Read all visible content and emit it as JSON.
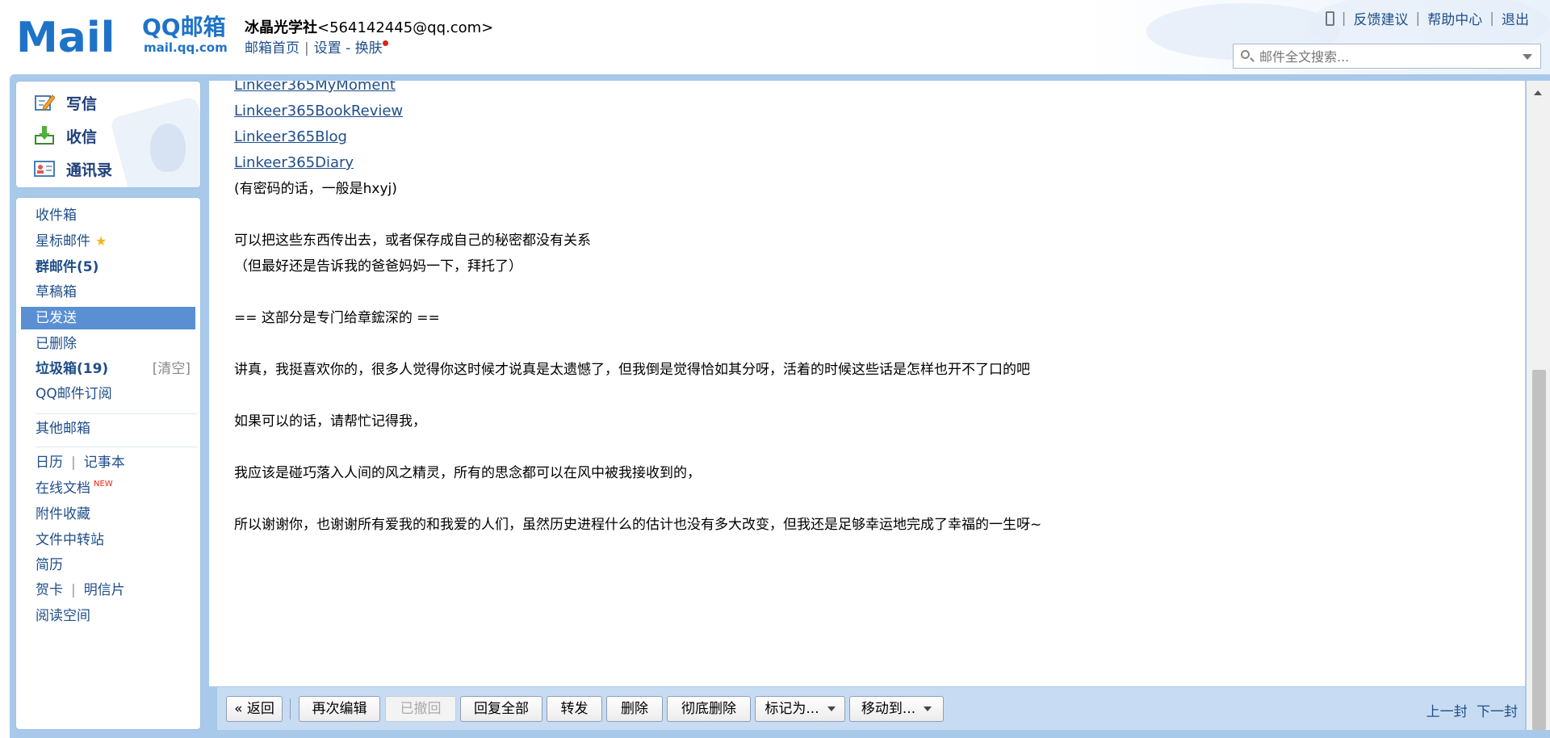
{
  "header": {
    "logo_text": "Mail",
    "logo_cn": "QQ邮箱",
    "logo_domain": "mail.qq.com",
    "account_name": "冰晶光学社",
    "account_email": "<564142445@qq.com>",
    "links": {
      "home": "邮箱首页",
      "settings": "设置",
      "dash": "-",
      "skin": "换肤"
    },
    "top_links": {
      "feedback": "反馈建议",
      "help": "帮助中心",
      "logout": "退出"
    },
    "search_placeholder": "邮件全文搜索..."
  },
  "sidebar": {
    "quick": {
      "compose": "写信",
      "inbox_check": "收信",
      "contacts": "通讯录"
    },
    "folders": {
      "inbox": "收件箱",
      "starred": "星标邮件",
      "groups": "群邮件(5)",
      "drafts": "草稿箱",
      "sent": "已发送",
      "deleted": "已删除",
      "spam": "垃圾箱(19)",
      "spam_clear": "[清空]",
      "subscriptions": "QQ邮件订阅",
      "other_mailboxes": "其他邮箱",
      "calendar": "日历",
      "notes": "记事本",
      "online_docs": "在线文档",
      "new_badge": "NEW",
      "attachments": "附件收藏",
      "file_transfer": "文件中转站",
      "resume": "简历",
      "cards": "贺卡",
      "postcards": "明信片",
      "reading": "阅读空间"
    }
  },
  "mail": {
    "partial_top": "Linkeer365MyMoment",
    "link1": "Linkeer365BookReview",
    "link2": "Linkeer365Blog",
    "link3": "Linkeer365Diary",
    "l_pw": "(有密码的话，一般是hxyj)",
    "l_share": "可以把这些东西传出去，或者保存成自己的秘密都没有关系",
    "l_parents": "（但最好还是告诉我的爸爸妈妈一下，拜托了）",
    "l_section": "== 这部分是专门给章鋐深的 ==",
    "l_like": "讲真，我挺喜欢你的，很多人觉得你这时候才说真是太遗憾了，但我倒是觉得恰如其分呀，活着的时候这些话是怎样也开不了口的吧",
    "l_remember": "如果可以的话，请帮忙记得我，",
    "l_wind": "我应该是碰巧落入人间的风之精灵，所有的思念都可以在风中被我接收到的，",
    "l_thanks": "所以谢谢你，也谢谢所有爱我的和我爱的人们，虽然历史进程什么的估计也没有多大改变，但我还是足够幸运地完成了幸福的一生呀~"
  },
  "toolbar": {
    "back": "« 返回",
    "edit_again": "再次编辑",
    "recalled": "已撤回",
    "reply_all": "回复全部",
    "forward": "转发",
    "delete": "删除",
    "delete_forever": "彻底删除",
    "mark_as": "标记为...",
    "move_to": "移动到...",
    "prev": "上一封",
    "next": "下一封"
  },
  "colors": {
    "accent": "#5a8fd3",
    "link": "#1f4e89",
    "frame": "#a9c9eb",
    "toolbar": "#c7dcf2"
  }
}
